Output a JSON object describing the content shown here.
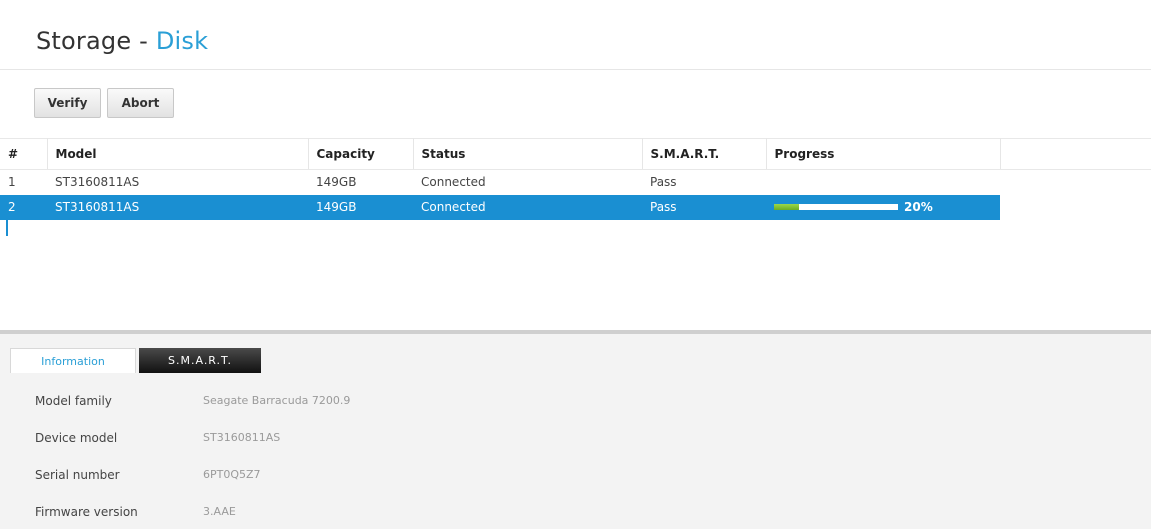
{
  "header": {
    "title_main": "Storage",
    "title_sep": "-",
    "title_sub": "Disk"
  },
  "toolbar": {
    "verify_label": "Verify",
    "abort_label": "Abort"
  },
  "table": {
    "columns": [
      "#",
      "Model",
      "Capacity",
      "Status",
      "S.M.A.R.T.",
      "Progress"
    ],
    "rows": [
      {
        "num": "1",
        "model": "ST3160811AS",
        "capacity": "149GB",
        "status": "Connected",
        "smart": "Pass",
        "progress": "",
        "selected": false
      },
      {
        "num": "2",
        "model": "ST3160811AS",
        "capacity": "149GB",
        "status": "Connected",
        "smart": "Pass",
        "progress": "20%",
        "progress_fraction": 0.2,
        "selected": true
      }
    ]
  },
  "details": {
    "tabs": [
      "Information",
      "S.M.A.R.T."
    ],
    "active_tab": "Information",
    "info": [
      {
        "label": "Model family",
        "value": "Seagate Barracuda 7200.9"
      },
      {
        "label": "Device model",
        "value": "ST3160811AS"
      },
      {
        "label": "Serial number",
        "value": "6PT0Q5Z7"
      },
      {
        "label": "Firmware version",
        "value": "3.AAE"
      }
    ]
  },
  "colors": {
    "accent": "#2a9fd6",
    "selection": "#1a8fd2",
    "progress_fill": "#7cc12e"
  }
}
